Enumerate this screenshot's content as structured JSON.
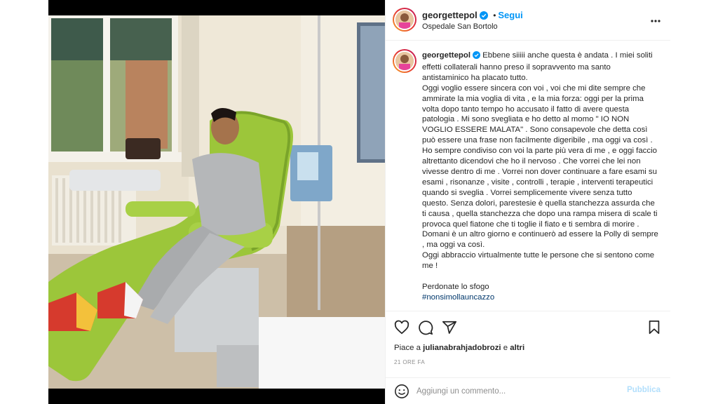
{
  "post": {
    "username": "georgettepol",
    "follow_label": "Segui",
    "dot": "•",
    "location": "Ospedale San Bortolo",
    "more_label": "•••"
  },
  "caption": {
    "username": "georgettepol",
    "text": " Ebbene siiiii anche questa è andata . I miei soliti effetti collaterali hanno preso il sopravvento ma santo antistaminico ha placato tutto.\nOggi voglio essere sincera con voi , voi che mi dite sempre che ammirate la mia voglia di vita , e la mia forza: oggi per la prima volta dopo tanto tempo ho accusato il fatto di avere questa patologia . Mi sono svegliata e ho detto al momo \" IO NON VOGLIO ESSERE MALATA\" . Sono consapevole che detta così può essere una frase non facilmente digeribile , ma oggi va così . Ho sempre condiviso con voi la parte più vera di me , e oggi faccio altrettanto dicendovi che ho il nervoso . Che vorrei che lei non vivesse dentro di me . Vorrei non dover continuare a fare esami su esami , risonanze , visite , controlli , terapie , interventi terapeutici quando si sveglia . Vorrei semplicemente vivere senza tutto questo. Senza dolori, parestesie è quella stanchezza assurda che ti causa , quella stanchezza che dopo una rampa misera di scale ti provoca quel fiatone che ti toglie il fiato e ti sembra di morire .\nDomani è un altro giorno e continuerò ad essere la Polly di sempre , ma oggi va così.\nOggi abbraccio virtualmente tutte le persone che si sentono come me !\n\nPerdonate lo sfogo\n",
    "hashtag": "#nonsimollauncazzo"
  },
  "actions": {
    "like_icon": "heart-icon",
    "comment_icon": "comment-icon",
    "share_icon": "share-icon",
    "save_icon": "bookmark-icon",
    "likes_prefix": "Piace a ",
    "likes_user": "julianabrahjadobrozi",
    "likes_suffix": " e ",
    "likes_others": "altri",
    "timestamp": "21 ORE FA"
  },
  "comment_box": {
    "emoji_icon": "emoji-icon",
    "placeholder": "Aggiungi un commento...",
    "publish_label": "Pubblica"
  },
  "colors": {
    "accent": "#0095f6",
    "publish_disabled": "#b2dffc",
    "hashtag": "#00376b",
    "verified": "#0095f6"
  }
}
